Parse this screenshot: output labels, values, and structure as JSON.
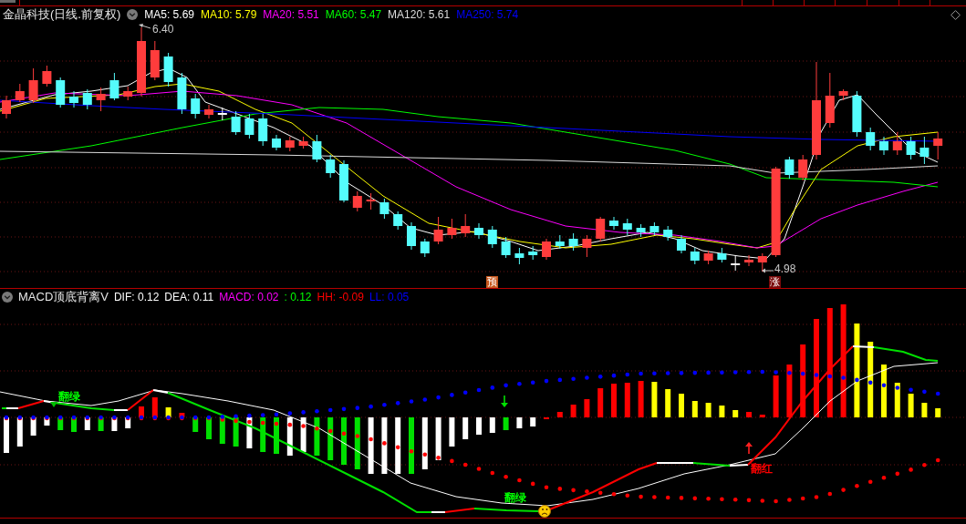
{
  "main_chart": {
    "title": "金晶科技(日线.前复权)",
    "indicators": [
      {
        "text": "MA5: 5.69",
        "color": "#ffffff"
      },
      {
        "text": "MA10: 5.79",
        "color": "#ffff00"
      },
      {
        "text": "MA20: 5.51",
        "color": "#ff00ff"
      },
      {
        "text": "MA60: 5.47",
        "color": "#00ff00"
      },
      {
        "text": "MA120: 5.61",
        "color": "#dcdcdc"
      },
      {
        "text": "MA250: 5.74",
        "color": "#0000ff"
      }
    ],
    "price_labels": [
      "6.40",
      "4.98"
    ],
    "badges": [
      {
        "text": "预",
        "color": "#c8581e"
      },
      {
        "text": "涨",
        "color": "#7a0a0a"
      }
    ]
  },
  "macd_panel": {
    "title": "MACD顶底背离V",
    "indicators": [
      {
        "text": "DIF: 0.12",
        "color": "#ffffff"
      },
      {
        "text": "DEA: 0.11",
        "color": "#ffffff"
      },
      {
        "text": "MACD: 0.02",
        "color": "#ff00ff"
      },
      {
        "text": ": 0.12",
        "color": "#00ff00"
      },
      {
        "text": "HH: -0.09",
        "color": "#ff0000"
      },
      {
        "text": "LL: 0.05",
        "color": "#0000ff"
      }
    ],
    "signals": [
      {
        "text": "翻绿",
        "color": "#00ff00"
      },
      {
        "text": "翻绿",
        "color": "#00ff00"
      },
      {
        "text": "翻红",
        "color": "#ff0000"
      }
    ]
  }
}
